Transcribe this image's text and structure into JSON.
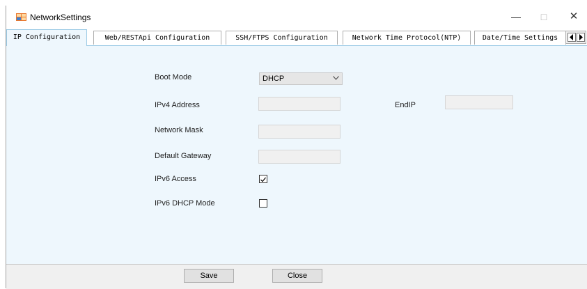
{
  "window": {
    "title": "NetworkSettings",
    "minimize": "—",
    "maximize": "□",
    "close": "✕"
  },
  "tabs": [
    {
      "label": "IP Configuration",
      "active": true
    },
    {
      "label": "Web/RESTApi Configuration",
      "active": false
    },
    {
      "label": "SSH/FTPS Configuration",
      "active": false
    },
    {
      "label": "Network Time Protocol(NTP)",
      "active": false
    },
    {
      "label": "Date/Time Settings",
      "active": false
    }
  ],
  "form": {
    "boot_mode_label": "Boot Mode",
    "boot_mode_value": "DHCP",
    "ipv4_label": "IPv4 Address",
    "ipv4_value": "",
    "endip_label": "EndIP",
    "endip_value": "",
    "mask_label": "Network Mask",
    "mask_value": "",
    "gateway_label": "Default Gateway",
    "gateway_value": "",
    "ipv6_access_label": "IPv6 Access",
    "ipv6_access_checked": true,
    "ipv6_dhcp_label": "IPv6 DHCP Mode",
    "ipv6_dhcp_checked": false
  },
  "buttons": {
    "save": "Save",
    "close": "Close"
  },
  "colors": {
    "panel_bg": "#eef7fd",
    "tab_active_border": "#9ccbe6",
    "footer_bg": "#f0f0f0"
  }
}
